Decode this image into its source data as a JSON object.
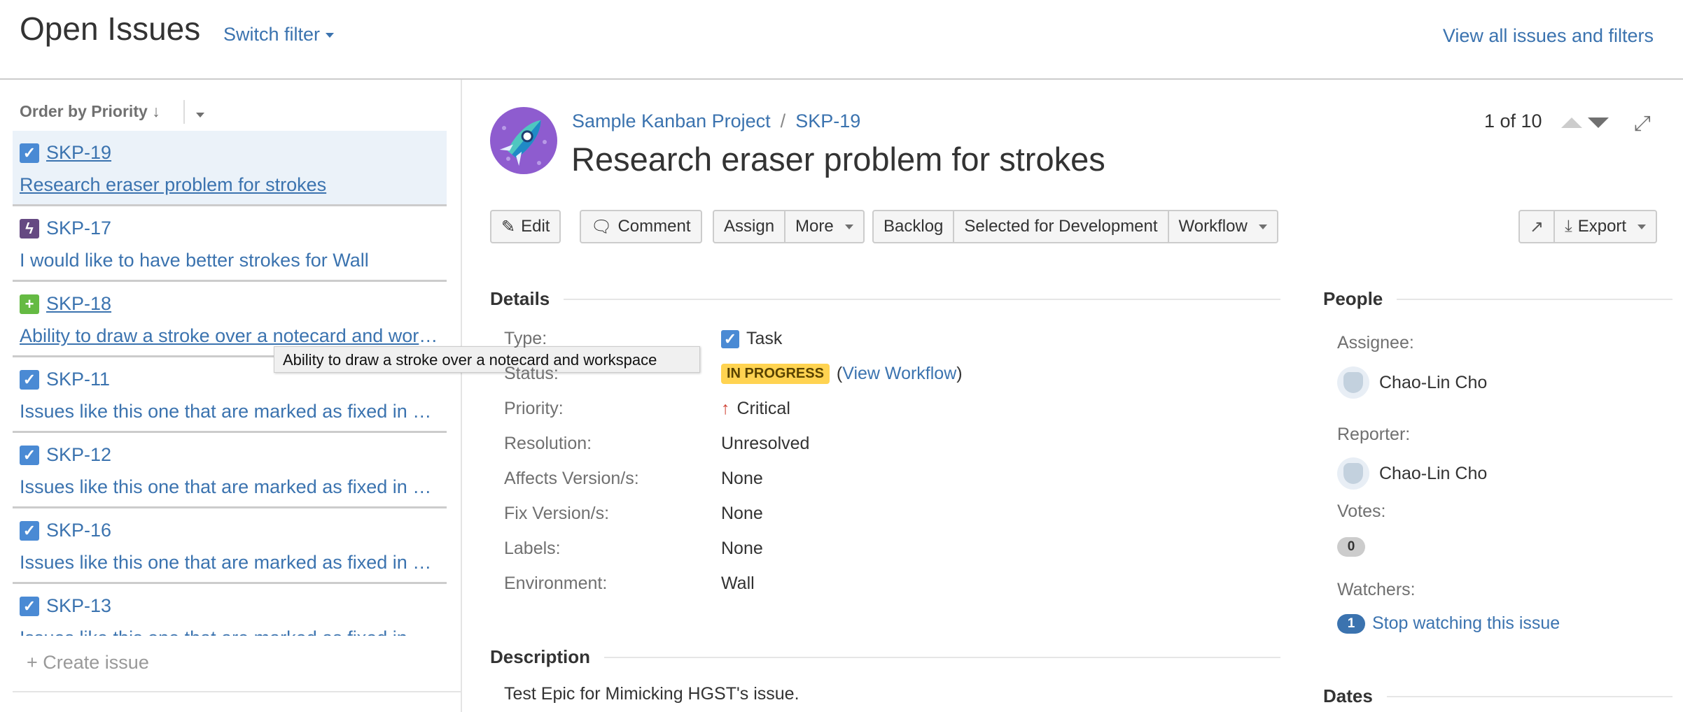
{
  "header": {
    "title": "Open Issues",
    "switch_filter": "Switch filter",
    "view_all": "View all issues and filters"
  },
  "sidebar": {
    "order_by": "Order by Priority ↓",
    "items": [
      {
        "key": "SKP-19",
        "summary": "Research eraser problem for strokes",
        "type": "task",
        "selected": true
      },
      {
        "key": "SKP-17",
        "summary": "I would like to have better strokes for Wall",
        "type": "epic"
      },
      {
        "key": "SKP-18",
        "summary": "Ability to draw a stroke over a notecard and workspace",
        "type": "new-feature"
      },
      {
        "key": "SKP-11",
        "summary": "Issues like this one that are marked as fixed in a released version",
        "type": "task"
      },
      {
        "key": "SKP-12",
        "summary": "Issues like this one that are marked as fixed in a released version",
        "type": "task"
      },
      {
        "key": "SKP-16",
        "summary": "Issues like this one that are marked as fixed in a released version",
        "type": "task"
      },
      {
        "key": "SKP-13",
        "summary": "Issues like this one that are marked as fixed in a released version",
        "type": "task"
      }
    ],
    "tooltip": "Ability to draw a stroke over a notecard and workspace",
    "create_issue": "+ Create issue"
  },
  "issue": {
    "project": "Sample Kanban Project",
    "separator": "/",
    "key": "SKP-19",
    "title": "Research eraser problem for strokes",
    "pager": "1 of 10",
    "toolbar": {
      "edit": "Edit",
      "comment": "Comment",
      "assign": "Assign",
      "more": "More",
      "backlog": "Backlog",
      "selected": "Selected for Development",
      "workflow": "Workflow",
      "export": "Export"
    },
    "details": {
      "heading": "Details",
      "fields": [
        {
          "label": "Type:",
          "value": "Task"
        },
        {
          "label": "Status:",
          "value": "IN PROGRESS",
          "extra_open": "(",
          "extra_link": "View Workflow",
          "extra_close": ")"
        },
        {
          "label": "Priority:",
          "value": "Critical"
        },
        {
          "label": "Resolution:",
          "value": "Unresolved"
        },
        {
          "label": "Affects Version/s:",
          "value": "None"
        },
        {
          "label": "Fix Version/s:",
          "value": "None"
        },
        {
          "label": "Labels:",
          "value": "None"
        },
        {
          "label": "Environment:",
          "value": "Wall"
        }
      ]
    },
    "description": {
      "heading": "Description",
      "text": "Test Epic for Mimicking HGST's issue."
    },
    "people": {
      "heading": "People",
      "assignee_label": "Assignee:",
      "assignee": "Chao-Lin Cho",
      "reporter_label": "Reporter:",
      "reporter": "Chao-Lin Cho",
      "votes_label": "Votes:",
      "votes": "0",
      "watchers_label": "Watchers:",
      "watchers": "1",
      "watch_link": "Stop watching this issue"
    },
    "dates": {
      "heading": "Dates"
    }
  },
  "colors": {
    "link": "#3b73af",
    "task": "#4a8ad4",
    "epic": "#654982",
    "new_feature": "#65ba43",
    "status": "#ffd351",
    "critical": "#d04437"
  }
}
